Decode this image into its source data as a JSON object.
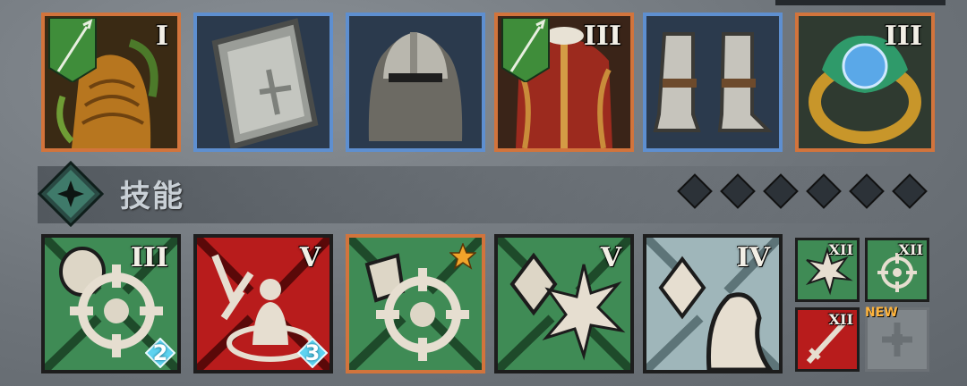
{
  "equipment": [
    {
      "name": "dragon-scale-armor-slot",
      "rarity": "orange",
      "tier": "I",
      "banner": true
    },
    {
      "name": "iron-shield-slot",
      "rarity": "blue",
      "tier": "",
      "banner": false
    },
    {
      "name": "steel-helmet-slot",
      "rarity": "blue",
      "tier": "",
      "banner": false
    },
    {
      "name": "red-gold-armor-slot",
      "rarity": "orange",
      "tier": "III",
      "banner": true
    },
    {
      "name": "plate-boots-slot",
      "rarity": "blue",
      "tier": "",
      "banner": false
    },
    {
      "name": "emerald-ring-slot",
      "rarity": "orange",
      "tier": "III",
      "banner": false
    }
  ],
  "skills_header": {
    "title": "技能",
    "pips": 6
  },
  "skills": [
    {
      "tier": "III",
      "badge": "2"
    },
    {
      "tier": "V",
      "badge": "3"
    },
    {
      "tier": "",
      "star": true
    },
    {
      "tier": "V"
    },
    {
      "tier": "IV"
    }
  ],
  "mini_skills": [
    {
      "tier": "XII"
    },
    {
      "tier": "XII"
    },
    {
      "tier": "XII"
    },
    {
      "label": "NEW"
    }
  ],
  "colors": {
    "orange": "#d2743c",
    "blue": "#5e8fd0",
    "skill_green": "#3f8b55",
    "skill_red": "#b81c1c"
  }
}
